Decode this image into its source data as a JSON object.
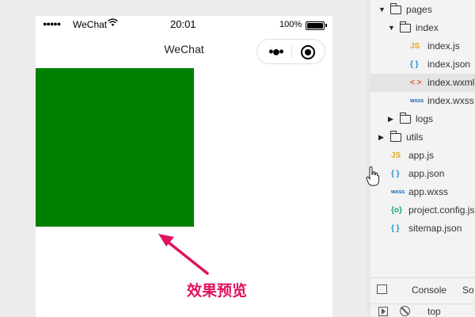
{
  "phone": {
    "status_bar": {
      "signal": "●●●●●",
      "carrier": "WeChat",
      "time": "20:01",
      "battery_percent": "100%"
    },
    "nav": {
      "title": "WeChat",
      "more_glyph": "•●•"
    },
    "content": {
      "block_color": "#008000"
    }
  },
  "annotation": {
    "caption": "效果预览",
    "color": "#e0115f"
  },
  "explorer": {
    "items": [
      {
        "type": "folder",
        "label": "pages",
        "expanded": true,
        "depth": 0
      },
      {
        "type": "folder",
        "label": "index",
        "expanded": true,
        "depth": 1
      },
      {
        "type": "js",
        "icon_text": "JS",
        "label": "index.js",
        "depth": 2
      },
      {
        "type": "json",
        "icon_text": "{ }",
        "label": "index.json",
        "depth": 2
      },
      {
        "type": "wxml",
        "icon_text": "< >",
        "label": "index.wxml",
        "depth": 2,
        "selected": true
      },
      {
        "type": "wxss",
        "icon_text": "wxss",
        "label": "index.wxss",
        "depth": 2
      },
      {
        "type": "folder",
        "label": "logs",
        "expanded": false,
        "depth": 1
      },
      {
        "type": "folder",
        "label": "utils",
        "expanded": false,
        "depth": 0
      },
      {
        "type": "js",
        "icon_text": "JS",
        "label": "app.js",
        "depth": 0
      },
      {
        "type": "json",
        "icon_text": "{ }",
        "label": "app.json",
        "depth": 0
      },
      {
        "type": "wxss",
        "icon_text": "wxss",
        "label": "app.wxss",
        "depth": 0
      },
      {
        "type": "config",
        "icon_text": "{o}",
        "label": "project.config.json",
        "depth": 0
      },
      {
        "type": "json",
        "icon_text": "{ }",
        "label": "sitemap.json",
        "depth": 0
      }
    ],
    "icon_colors": {
      "js": "#e5a91b",
      "json": "#1f8fd6",
      "wxml": "#e8542b",
      "wxss": "#1a5fb4",
      "config": "#16a37c"
    },
    "devtools": {
      "tab_console": "Console",
      "tab_sources": "So",
      "context": "top"
    }
  }
}
